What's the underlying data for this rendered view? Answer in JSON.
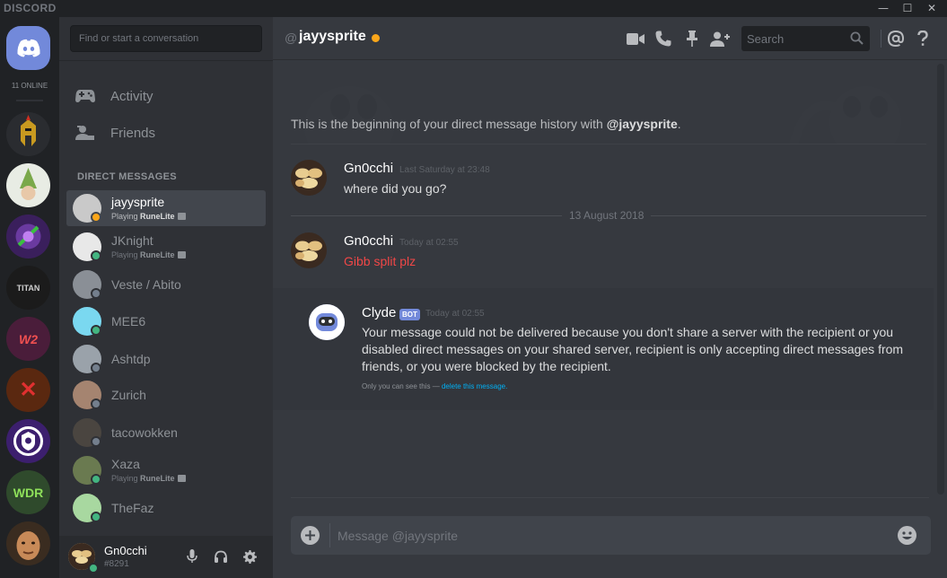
{
  "titlebar": {
    "brand": "DISCORD",
    "minimize": "—",
    "maximize": "☐",
    "close": "✕"
  },
  "rail": {
    "online_count": "11 ONLINE",
    "servers": [
      {
        "name": "spartan-helmet",
        "bg": "#2a2c30",
        "fg": "#e0b020",
        "text": ""
      },
      {
        "name": "gnome-child",
        "bg": "#e8ece4",
        "fg": "#6a9a3a",
        "text": ""
      },
      {
        "name": "purple-rune",
        "bg": "#3a1f5c",
        "fg": "#b06ae0",
        "text": ""
      },
      {
        "name": "titan",
        "bg": "#1b1b1b",
        "fg": "#cfcfcf",
        "text": "TITAN"
      },
      {
        "name": "wilderness-red",
        "bg": "#4a1d3a",
        "fg": "#f05050",
        "text": "W2"
      },
      {
        "name": "crossed-out",
        "bg": "#5a2810",
        "fg": "#e03030",
        "text": "✕"
      },
      {
        "name": "purple-shield",
        "bg": "#3c1f6e",
        "fg": "#ffffff",
        "text": ""
      },
      {
        "name": "wdr",
        "bg": "#2f4a2c",
        "fg": "#8ee05a",
        "text": "WDR"
      },
      {
        "name": "bald-face",
        "bg": "#4a3a2a",
        "fg": "#d8a070",
        "text": ""
      }
    ]
  },
  "sidebar": {
    "search_placeholder": "Find or start a conversation",
    "nav": [
      {
        "label": "Activity",
        "icon": "gamepad-icon"
      },
      {
        "label": "Friends",
        "icon": "friends-icon"
      }
    ],
    "dm_header": "DIRECT MESSAGES",
    "dms": [
      {
        "name": "jayysprite",
        "status": "idle",
        "playing": "Playing ",
        "game": "RuneLite",
        "active": true,
        "avatar": "#c9c9c9"
      },
      {
        "name": "JKnight",
        "status": "online",
        "playing": "Playing ",
        "game": "RuneLite",
        "active": false,
        "avatar": "#e8e8e8"
      },
      {
        "name": "Veste / Abito",
        "status": "offline",
        "playing": "",
        "game": "",
        "active": false,
        "avatar": "#8a8f96"
      },
      {
        "name": "MEE6",
        "status": "online",
        "playing": "",
        "game": "",
        "active": false,
        "avatar": "#7ad8f0"
      },
      {
        "name": "Ashtdp",
        "status": "offline",
        "playing": "",
        "game": "",
        "active": false,
        "avatar": "#9aa2aa"
      },
      {
        "name": "Zurich",
        "status": "offline",
        "playing": "",
        "game": "",
        "active": false,
        "avatar": "#a58470"
      },
      {
        "name": "tacowokken",
        "status": "offline",
        "playing": "",
        "game": "",
        "active": false,
        "avatar": "#4a4540"
      },
      {
        "name": "Xaza",
        "status": "online",
        "playing": "Playing ",
        "game": "RuneLite",
        "active": false,
        "avatar": "#6a7a50"
      },
      {
        "name": "TheFaz",
        "status": "online",
        "playing": "",
        "game": "",
        "active": false,
        "avatar": "#a8d8a0"
      }
    ]
  },
  "user": {
    "name": "Gn0cchi",
    "tag": "#8291",
    "status": "online"
  },
  "channel": {
    "at": "@",
    "name": "jayysprite",
    "search_placeholder": "Search",
    "intro_prefix": "This is the beginning of your direct message history with ",
    "intro_user": "@jayysprite",
    "intro_suffix": "."
  },
  "messages": [
    {
      "author": "Gn0cchi",
      "timestamp": "Last Saturday at 23:48",
      "text": "where did you go?"
    },
    {
      "author": "Gn0cchi",
      "timestamp": "Today at 02:55",
      "text": "Gibb split plz"
    }
  ],
  "date_divider": "13 August 2018",
  "clyde": {
    "author": "Clyde",
    "bot_tag": "BOT",
    "timestamp": "Today at 02:55",
    "text": "Your message could not be delivered because you don't share a server with the recipient or you disabled direct messages on your shared server, recipient is only accepting direct messages from friends, or you were blocked by the recipient.",
    "note_prefix": "Only you can see this — ",
    "note_link": "delete this message."
  },
  "composer": {
    "placeholder": "Message @jayysprite"
  },
  "colors": {
    "blurple": "#7289da",
    "online": "#43b581",
    "idle": "#faa61a",
    "offline": "#747f8d",
    "error_text": "#f04747",
    "link": "#00b0f4"
  }
}
